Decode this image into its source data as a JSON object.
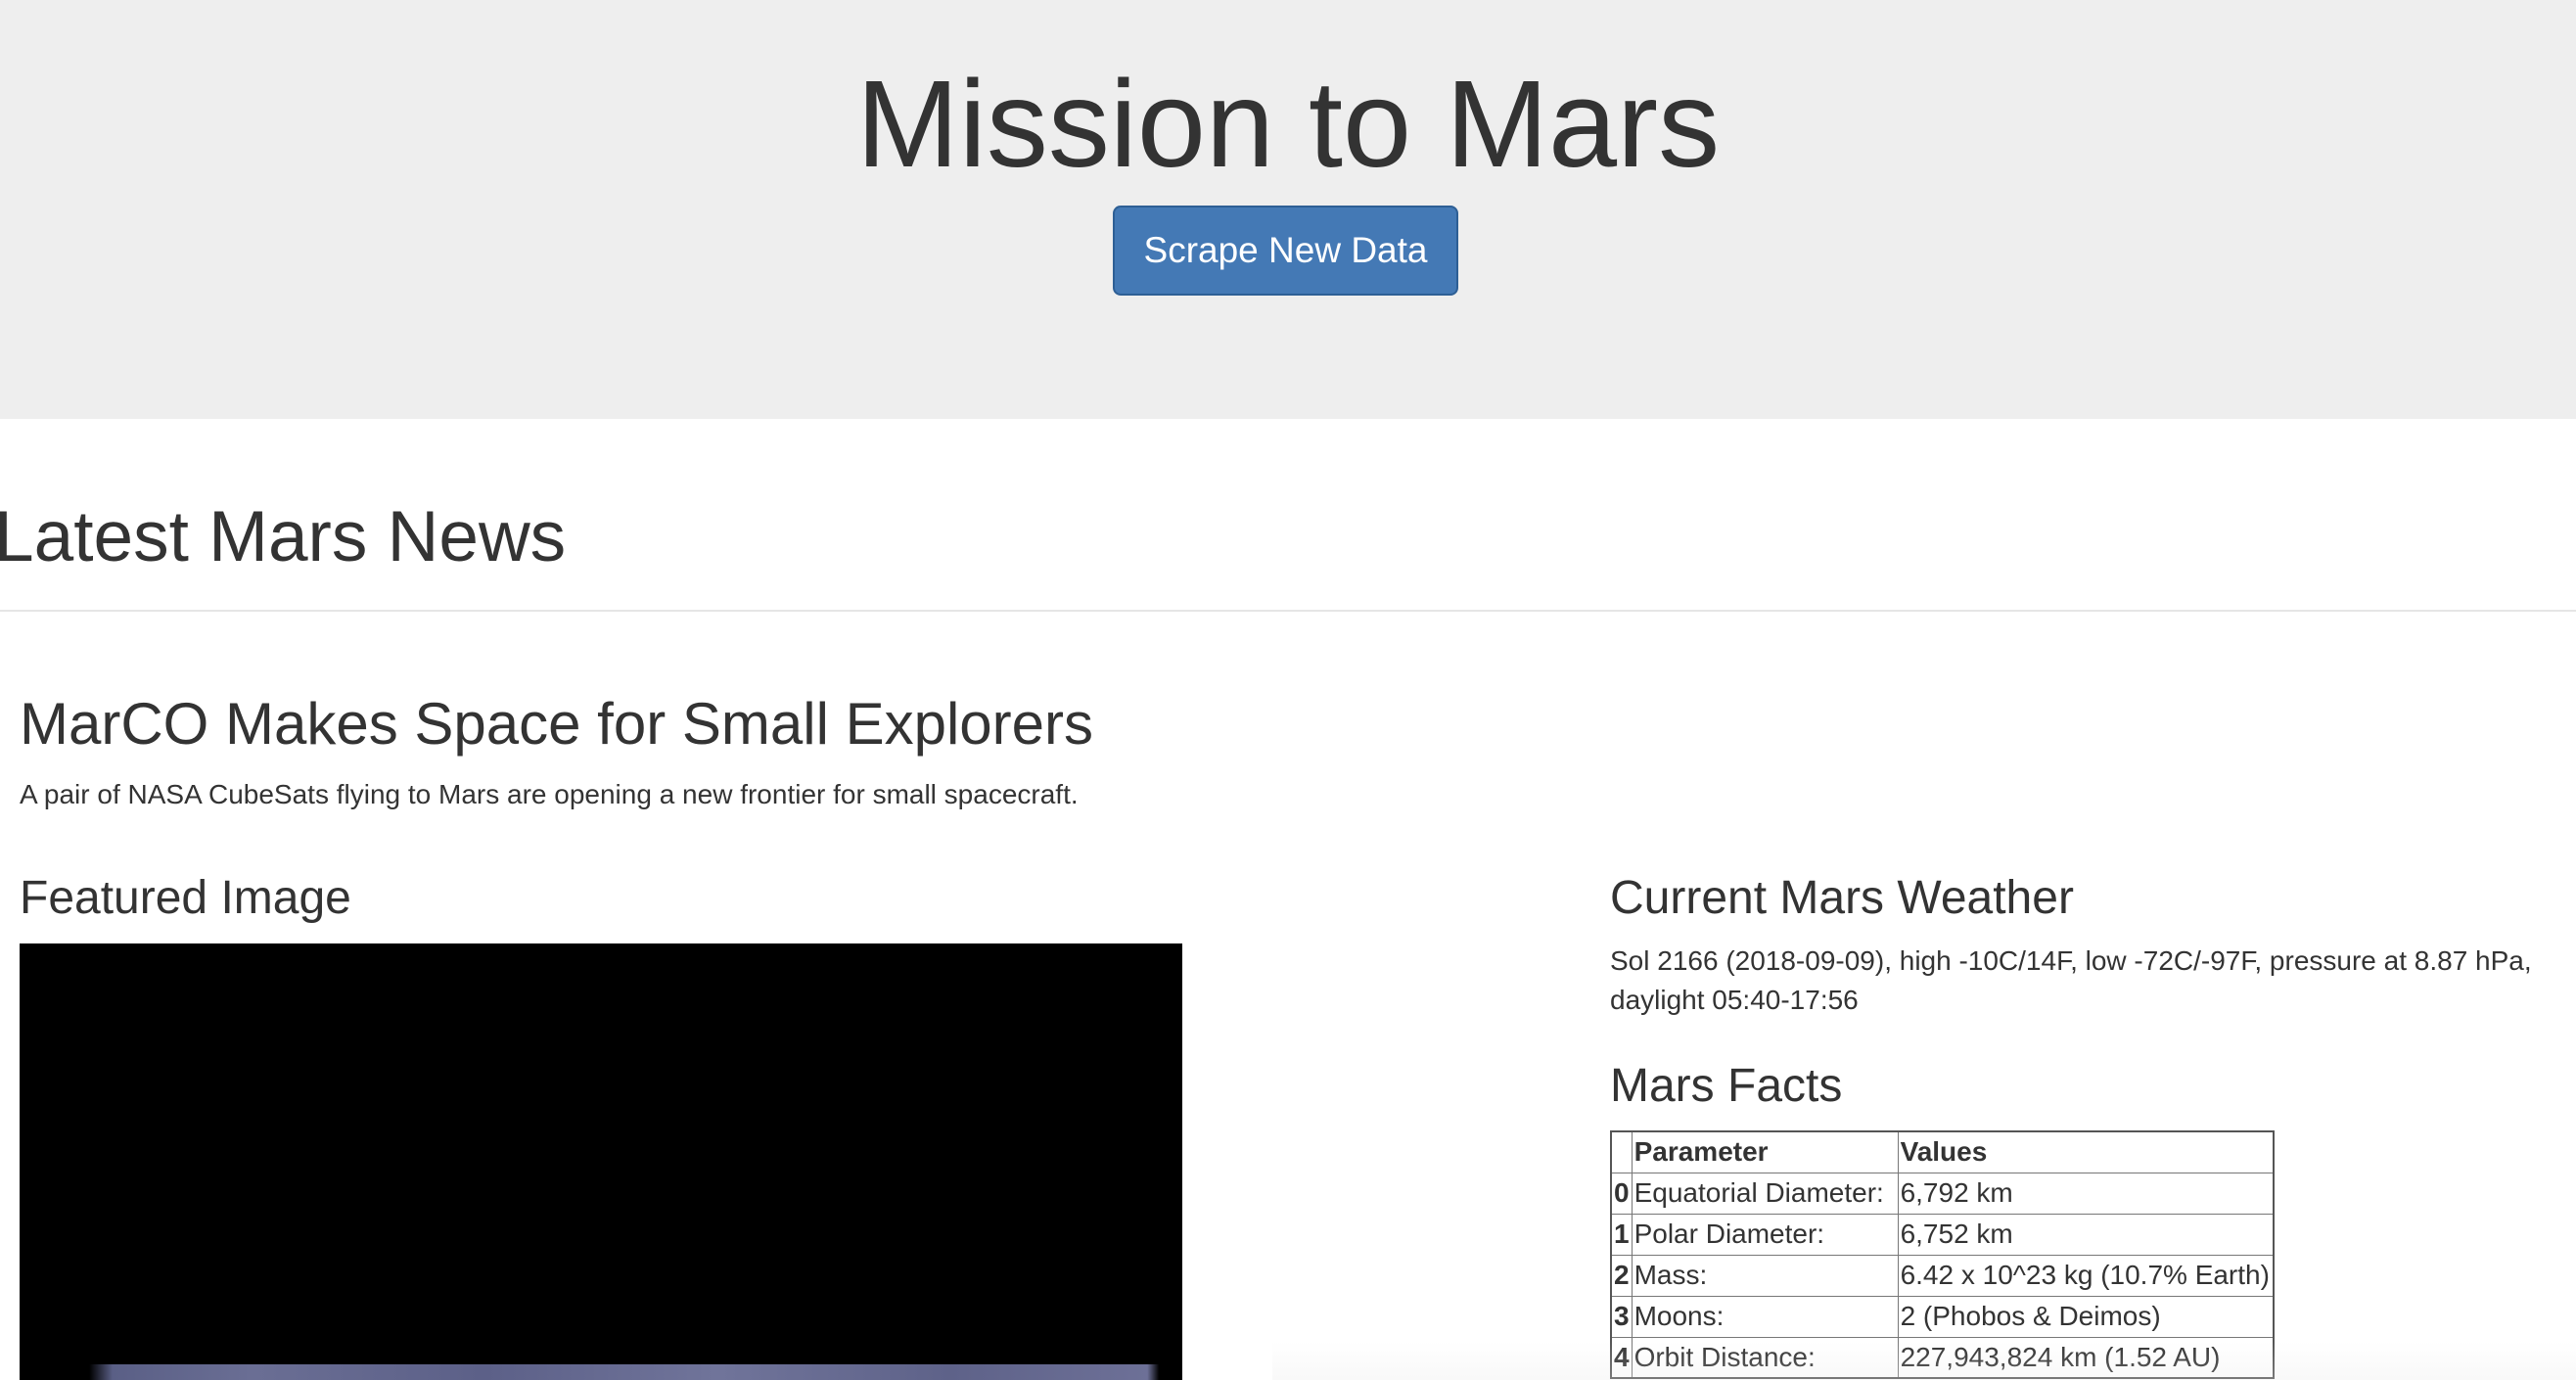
{
  "header": {
    "title": "Mission to Mars",
    "scrape_button_label": "Scrape New Data"
  },
  "news": {
    "section_heading": "Latest Mars News",
    "title": "MarCO Makes Space for Small Explorers",
    "teaser": "A pair of NASA CubeSats flying to Mars are opening a new frontier for small spacecraft."
  },
  "featured": {
    "heading": "Featured Image"
  },
  "weather": {
    "heading": "Current Mars Weather",
    "text": "Sol 2166 (2018-09-09), high -10C/14F, low -72C/-97F, pressure at 8.87 hPa, daylight 05:40-17:56"
  },
  "facts": {
    "heading": "Mars Facts",
    "columns": [
      "",
      "Parameter",
      "Values"
    ],
    "rows": [
      {
        "index": "0",
        "parameter": "Equatorial Diameter:",
        "value": "6,792 km"
      },
      {
        "index": "1",
        "parameter": "Polar Diameter:",
        "value": "6,752 km"
      },
      {
        "index": "2",
        "parameter": "Mass:",
        "value": "6.42 x 10^23 kg (10.7% Earth)"
      },
      {
        "index": "3",
        "parameter": "Moons:",
        "value": "2 (Phobos & Deimos)"
      },
      {
        "index": "4",
        "parameter": "Orbit Distance:",
        "value": "227,943,824 km (1.52 AU)"
      }
    ]
  },
  "colors": {
    "button_primary": "#4479b5",
    "jumbotron_bg": "#eeeeee",
    "text": "#333333"
  }
}
